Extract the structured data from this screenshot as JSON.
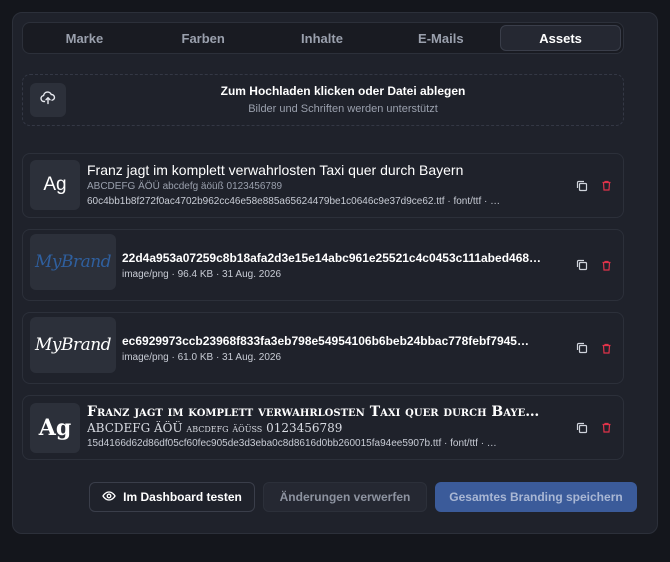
{
  "tabs": [
    {
      "label": "Marke"
    },
    {
      "label": "Farben"
    },
    {
      "label": "Inhalte"
    },
    {
      "label": "E-Mails"
    },
    {
      "label": "Assets",
      "active": true
    }
  ],
  "upload": {
    "title": "Zum Hochladen klicken oder Datei ablegen",
    "subtitle": "Bilder und Schriften werden unterstützt",
    "icon": "cloud-upload-icon"
  },
  "assets": [
    {
      "thumb": "Ag",
      "title": "Franz jagt im komplett verwahrlosten Taxi quer durch Bayern",
      "chars": "ABCDEFG ÄÖÜ abcdefg äöüß 0123456789",
      "meta": "60c4bb1b8f272f0ac4702b962cc46e58e885a65624479be1c0646c9e37d9ce62.ttf · font/ttf · …"
    },
    {
      "thumb": "MyBrand",
      "title": "22d4a953a07259c8b18afa2d3e15e14abc961e25521c4c0453c111abed468…",
      "meta": "image/png · 96.4 KB · 31 Aug. 2026"
    },
    {
      "thumb": "MyBrand",
      "title": "ec6929973ccb23968f833fa3eb798e54954106b6beb24bbac778febf7945…",
      "meta": "image/png · 61.0 KB · 31 Aug. 2026"
    },
    {
      "thumb": "Ag",
      "title": "Franz jagt im komplett verwahrlosten Taxi quer durch Baye…",
      "chars": "ABCDEFG ÄÖÜ abcdefg äöüß 0123456789",
      "meta": "15d4166d62d86df05cf60fec905de3d3eba0c8d8616d0bb260015fa94ee5907b.ttf · font/ttf · …"
    }
  ],
  "footer": {
    "test_label": "Im Dashboard testen",
    "discard_label": "Änderungen verwerfen",
    "save_label": "Gesamtes Branding speichern"
  },
  "colors": {
    "accent": "#3b5b9a",
    "delete": "#e0334a",
    "panel": "#1f222b"
  }
}
